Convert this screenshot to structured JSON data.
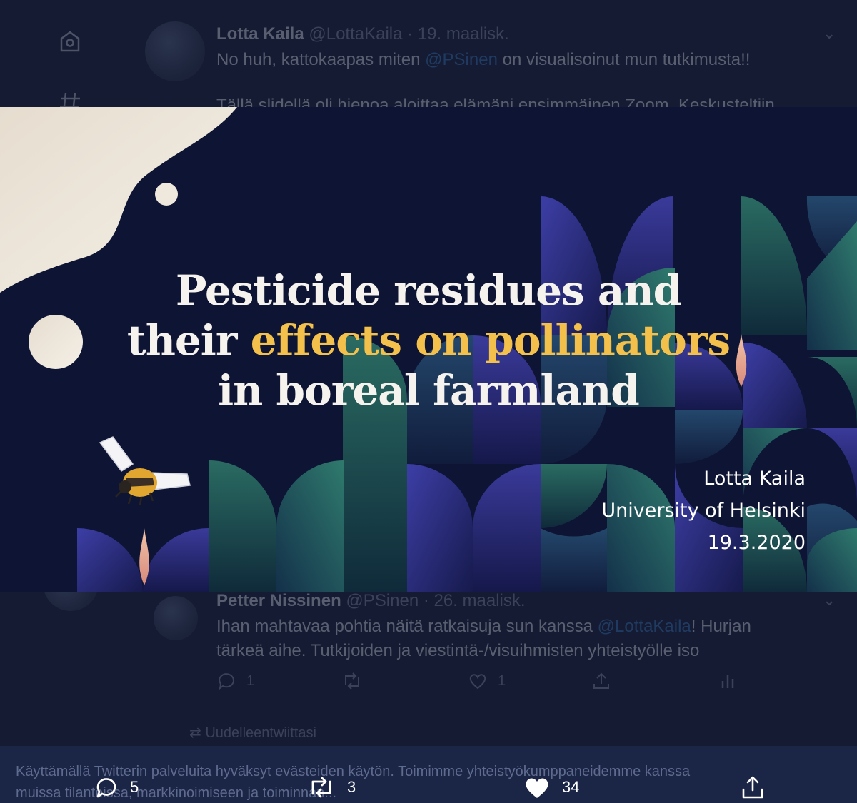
{
  "background": {
    "tweet1": {
      "name": "Lotta Kaila",
      "handle": "@LottaKaila",
      "date": "· 19. maalisk.",
      "text_before": "No huh, kattokaapas miten ",
      "mention": "@PSinen",
      "text_after": " on visualisoinut mun tutkimusta!!",
      "text2": "Tällä slidellä oli hienoa aloittaa elämäni ensimmäinen Zoom. Keskusteltiin"
    },
    "tweet2": {
      "name": "Petter Nissinen",
      "handle": "@PSinen",
      "date": "· 26. maalisk.",
      "line1_before": "Ihan mahtavaa pohtia näitä ratkaisuja sun kanssa ",
      "line1_mention": "@LottaKaila",
      "line1_after": "! Hurjan",
      "line2": "tärkeä aihe. Tutkijoiden ja viestintä-/visuihmisten yhteistyölle iso",
      "reply_count": "1",
      "like_count": "1"
    },
    "retweeted_label": "Uudelleentwiittasi",
    "cookie_line1": "Käyttämällä Twitterin palveluita hyväksyt evästeiden käytön. Toimimme yhteistyökumppaneidemme kanssa",
    "cookie_line2": "muissa tilanteissa, markkinoimiseen ja toiminnan..."
  },
  "slide": {
    "title_line1": "Pesticide residues and",
    "title_line2_pre": "their ",
    "title_line2_highlight": "effects on pollinators",
    "title_line3": "in boreal farmland",
    "author": "Lotta Kaila",
    "affiliation": "University of Helsinki",
    "date": "19.3.2020",
    "colors": {
      "background": "#0e1434",
      "highlight": "#f2c04b",
      "cream": "#efe8dc",
      "teal": "#1f5a55",
      "indigo": "#2c2c7a"
    }
  },
  "actions": {
    "replies": "5",
    "retweets": "3",
    "likes": "34"
  }
}
